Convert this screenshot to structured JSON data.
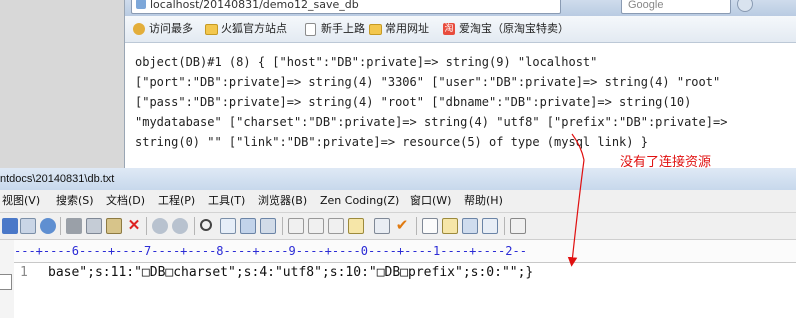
{
  "browser": {
    "url_fragment": "localhost/20140831/demo12_save_db",
    "search_placeholder": "Google",
    "bookmarks": [
      {
        "label": "访问最多",
        "icon": "gear-icon"
      },
      {
        "label": "火狐官方站点",
        "icon": "folder-icon"
      },
      {
        "label": "新手上路",
        "icon": "page-icon"
      },
      {
        "label": "常用网址",
        "icon": "folder-icon"
      },
      {
        "label": "爱淘宝（原淘宝特卖）",
        "icon": "taobao-icon"
      }
    ],
    "output_lines": [
      "object(DB)#1 (8) { [\"host\":\"DB\":private]=> string(9) \"localhost\"",
      "[\"port\":\"DB\":private]=> string(4) \"3306\" [\"user\":\"DB\":private]=> string(4) \"root\"",
      "[\"pass\":\"DB\":private]=> string(4) \"root\" [\"dbname\":\"DB\":private]=> string(10)",
      "\"mydatabase\" [\"charset\":\"DB\":private]=> string(4) \"utf8\" [\"prefix\":\"DB\":private]=>",
      "string(0) \"\" [\"link\":\"DB\":private]=> resource(5) of type (mysql link) }"
    ]
  },
  "annotation": {
    "text": "没有了连接资源",
    "color": "#e01010"
  },
  "editor": {
    "title": "ntdocs\\20140831\\db.txt",
    "menu": [
      "视图(V)",
      "搜索(S)",
      "文档(D)",
      "工程(P)",
      "工具(T)",
      "浏览器(B)",
      "Zen Coding(Z)",
      "窗口(W)",
      "帮助(H)"
    ],
    "ruler": "---+----6----+----7----+----8----+----9----+----0----+----1----+----2--",
    "line_number": "1",
    "code_line": "base\";s:11:\"\u0000DB\u0000charset\";s:4:\"utf8\";s:10:\"\u0000DB\u0000prefix\";s:0:\"\";}"
  }
}
